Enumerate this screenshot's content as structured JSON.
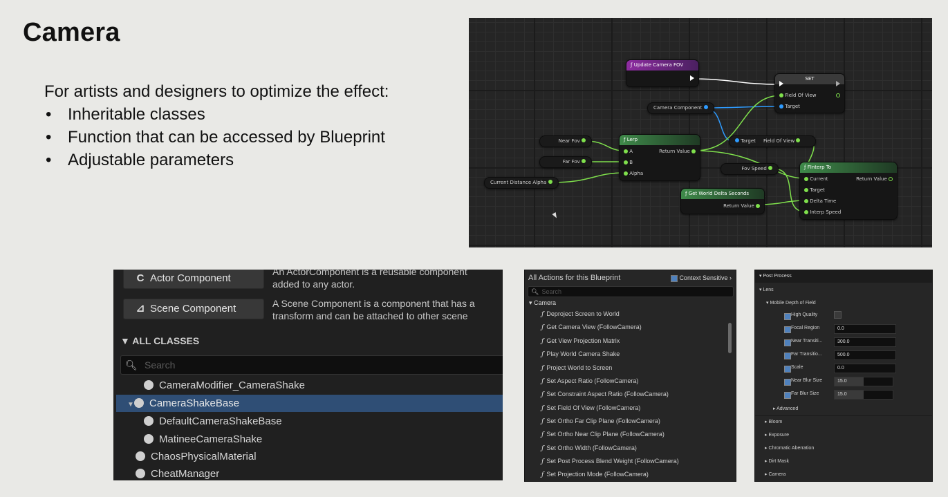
{
  "slide": {
    "title": "Camera",
    "intro": "For artists and designers to optimize the effect:",
    "bullets": [
      "Inheritable classes",
      "Function that can be accessed by Blueprint",
      "Adjustable parameters"
    ],
    "bullet_char": "•"
  },
  "graph": {
    "update_fov": "Update Camera FOV",
    "set": "SET",
    "field_of_view": "Field Of View",
    "target": "Target",
    "camera_component": "Camera Component",
    "near_fov": "Near Fov",
    "far_fov": "Far Fov",
    "current_distance_alpha": "Current Distance Alpha",
    "lerp": "Lerp",
    "lerp_a": "A",
    "lerp_b": "B",
    "lerp_alpha": "Alpha",
    "return_value": "Return Value",
    "get_target": "Target",
    "get_field_of_view": "Field Of View",
    "fov_speed": "Fov Speed",
    "finterp": "FInterp To",
    "current": "Current",
    "finterp_target": "Target",
    "delta_time": "Delta Time",
    "interp_speed": "Interp Speed",
    "finterp_return": "Return Value",
    "get_delta": "Get World Delta Seconds",
    "delta_return": "Return Value",
    "func_glyph": "ƒ"
  },
  "classes": {
    "buttons": [
      {
        "label": "Actor Component",
        "icon": "C",
        "desc1": "An ActorComponent is a reusable component",
        "desc2": "added to any actor."
      },
      {
        "label": "Scene Component",
        "icon": "⊿",
        "desc1": "A Scene Component is a component that has a",
        "desc2": "transform and can be attached to other scene"
      }
    ],
    "section": "ALL CLASSES",
    "search_placeholder": "Search",
    "items": [
      {
        "label": "CameraModifier_CameraShake",
        "indent": 2,
        "selected": false,
        "expander": ""
      },
      {
        "label": "CameraShakeBase",
        "indent": 1,
        "selected": true,
        "expander": "▼"
      },
      {
        "label": "DefaultCameraShakeBase",
        "indent": 2,
        "selected": false,
        "expander": ""
      },
      {
        "label": "MatineeCameraShake",
        "indent": 2,
        "selected": false,
        "expander": ""
      },
      {
        "label": "ChaosPhysicalMaterial",
        "indent": 1,
        "selected": false,
        "expander": ""
      },
      {
        "label": "CheatManager",
        "indent": 1,
        "selected": false,
        "expander": ""
      }
    ]
  },
  "actions": {
    "title": "All Actions for this Blueprint",
    "context_sensitive": "Context Sensitive",
    "search_placeholder": "Search",
    "category": "Camera",
    "items": [
      "Deproject Screen to World",
      "Get Camera View (FollowCamera)",
      "Get View Projection Matrix",
      "Play World Camera Shake",
      "Project World to Screen",
      "Set Aspect Ratio (FollowCamera)",
      "Set Constraint Aspect Ratio (FollowCamera)",
      "Set Field Of View (FollowCamera)",
      "Set Ortho Far Clip Plane (FollowCamera)",
      "Set Ortho Near Clip Plane (FollowCamera)",
      "Set Ortho Width (FollowCamera)",
      "Set Post Process Blend Weight (FollowCamera)",
      "Set Projection Mode (FollowCamera)"
    ]
  },
  "post": {
    "header": "Post Process",
    "lens": "Lens",
    "mobile_dof": "Mobile Depth of Field",
    "rows": [
      {
        "label": "High Quality",
        "kind": "checkbox",
        "value": ""
      },
      {
        "label": "Focal Region",
        "kind": "value",
        "value": "0.0"
      },
      {
        "label": "Near Transiti...",
        "kind": "value",
        "value": "300.0"
      },
      {
        "label": "Far Transitio...",
        "kind": "value",
        "value": "500.0"
      },
      {
        "label": "Scale",
        "kind": "value",
        "value": "0.0"
      },
      {
        "label": "Near Blur Size",
        "kind": "slider",
        "value": "15.0",
        "fill": 0.45
      },
      {
        "label": "Far Blur Size",
        "kind": "slider",
        "value": "15.0",
        "fill": 0.45
      }
    ],
    "advanced": "Advanced",
    "collapsed": [
      "Bloom",
      "Exposure",
      "Chromatic Aberration",
      "Dirt Mask",
      "Camera"
    ]
  }
}
